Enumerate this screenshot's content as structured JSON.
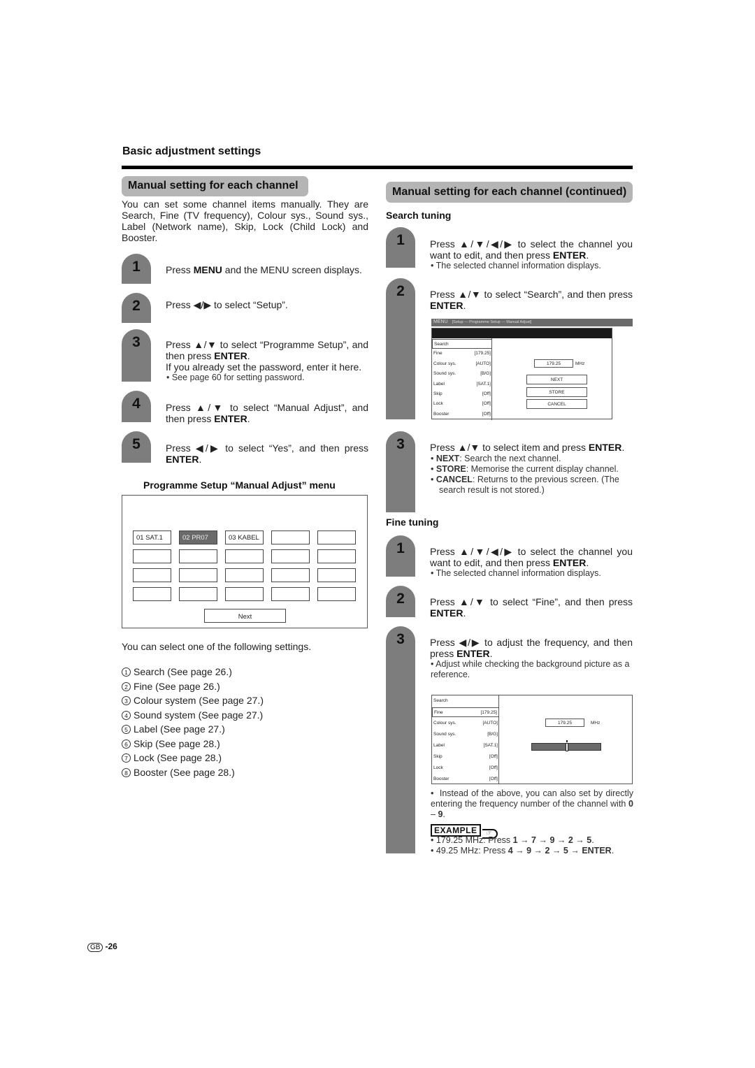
{
  "section_title": "Basic adjustment settings",
  "left": {
    "heading": "Manual setting for each channel",
    "intro": "You can set some channel items manually. They are Search, Fine (TV frequency), Colour sys., Sound sys., Label (Network name), Skip, Lock (Child Lock) and Booster.",
    "steps": [
      {
        "num": "1",
        "pre": "Press ",
        "bold": "MENU",
        "post": " and the MENU screen displays."
      },
      {
        "num": "2",
        "text": "Press ◀/▶ to select “Setup”."
      },
      {
        "num": "3",
        "pre": "Press ▲/▼ to select “Programme Setup”, and then press ",
        "bold": "ENTER",
        "post": ".",
        "extra": "If you already set the password, enter it here.",
        "note": "See page 60 for setting password."
      },
      {
        "num": "4",
        "pre": "Press ▲/▼ to select “Manual Adjust”, and then press ",
        "bold": "ENTER",
        "post": "."
      },
      {
        "num": "5",
        "pre": "Press ◀/▶ to select “Yes”, and then press ",
        "bold": "ENTER",
        "post": "."
      }
    ],
    "menu_caption": "Programme Setup “Manual Adjust” menu",
    "channel_grid": [
      [
        "01  SAT.1",
        "02  PR07",
        "03  KABEL",
        "",
        ""
      ],
      [
        "",
        "",
        "",
        "",
        ""
      ],
      [
        "",
        "",
        "",
        "",
        ""
      ],
      [
        "",
        "",
        "",
        "",
        ""
      ]
    ],
    "selected_channel": "02  PR07",
    "next_label": "Next",
    "settings_intro": "You can select one of the following settings.",
    "settings": [
      {
        "num": "1",
        "text": "Search (See page 26.)"
      },
      {
        "num": "2",
        "text": "Fine (See page 26.)"
      },
      {
        "num": "3",
        "text": "Colour system (See page 27.)"
      },
      {
        "num": "4",
        "text": "Sound system (See page 27.)"
      },
      {
        "num": "5",
        "text": "Label (See page 27.)"
      },
      {
        "num": "6",
        "text": "Skip (See page 28.)"
      },
      {
        "num": "7",
        "text": "Lock (See page 28.)"
      },
      {
        "num": "8",
        "text": "Booster (See page 28.)"
      }
    ]
  },
  "right": {
    "heading": "Manual setting for each channel (continued)",
    "search_tuning": {
      "title": "Search tuning",
      "steps": [
        {
          "num": "1",
          "pre": "Press ▲/▼/◀/▶ to select the channel you want to edit, and then press ",
          "bold": "ENTER",
          "post": ".",
          "note": "The selected channel information displays."
        },
        {
          "num": "2",
          "pre": "Press ▲/▼ to select “Search”, and then press ",
          "bold": "ENTER",
          "post": "."
        },
        {
          "num": "3",
          "pre": "Press ▲/▼ to select item and press ",
          "bold": "ENTER",
          "post": "."
        }
      ],
      "options": [
        {
          "key": "NEXT",
          "desc": ": Search the next channel."
        },
        {
          "key": "STORE",
          "desc": ": Memorise the current display channel."
        },
        {
          "key": "CANCEL",
          "desc": ": Returns to the previous screen. (The search result is not stored.)"
        }
      ]
    },
    "osd": {
      "menu_label": "MENU",
      "breadcrumb": "[Setup --- Programme Setup --- Manual Adjust]",
      "rows": [
        {
          "label": "Search",
          "value": ""
        },
        {
          "label": "Fine",
          "value": "[179.25]"
        },
        {
          "label": "Colour sys.",
          "value": "[AUTO]"
        },
        {
          "label": "Sound sys.",
          "value": "[B/G]"
        },
        {
          "label": "Label",
          "value": "[SAT.1]"
        },
        {
          "label": "Skip",
          "value": "[Off]"
        },
        {
          "label": "Lock",
          "value": "[Off]"
        },
        {
          "label": "Booster",
          "value": "[Off]"
        }
      ],
      "frequency": "179.25",
      "unit": "MHz",
      "buttons": {
        "next": "NEXT",
        "store": "STORE",
        "cancel": "CANCEL"
      },
      "fine_slider_position": 0.5
    },
    "fine_tuning": {
      "title": "Fine tuning",
      "steps": [
        {
          "num": "1",
          "pre": "Press ▲/▼/◀/▶ to select the channel you want to edit, and then press ",
          "bold": "ENTER",
          "post": ".",
          "note": "The selected channel information displays."
        },
        {
          "num": "2",
          "pre": "Press ▲/▼ to select “Fine”, and then press ",
          "bold": "ENTER",
          "post": "."
        },
        {
          "num": "3",
          "pre": "Press ◀/▶ to adjust the frequency, and then press ",
          "bold": "ENTER",
          "post": ".",
          "note": "Adjust while checking the background picture as a reference."
        }
      ],
      "direct_entry_pre": "Instead of the above, you can also set by directly entering the frequency number of the channel with ",
      "direct_entry_bold": "0",
      "direct_entry_mid": " – ",
      "direct_entry_bold2": "9",
      "direct_entry_post": ".",
      "example_label": "EXAMPLE",
      "examples": [
        {
          "freq": "179.25 MHz: Press ",
          "keys": [
            "1",
            "7",
            "9",
            "2",
            "5"
          ],
          "end": "."
        },
        {
          "freq": "49.25 MHz: Press ",
          "keys": [
            "4",
            "9",
            "2",
            "5",
            "ENTER"
          ],
          "end": "."
        }
      ]
    }
  },
  "footer": {
    "region": "GB",
    "page": "-26"
  }
}
